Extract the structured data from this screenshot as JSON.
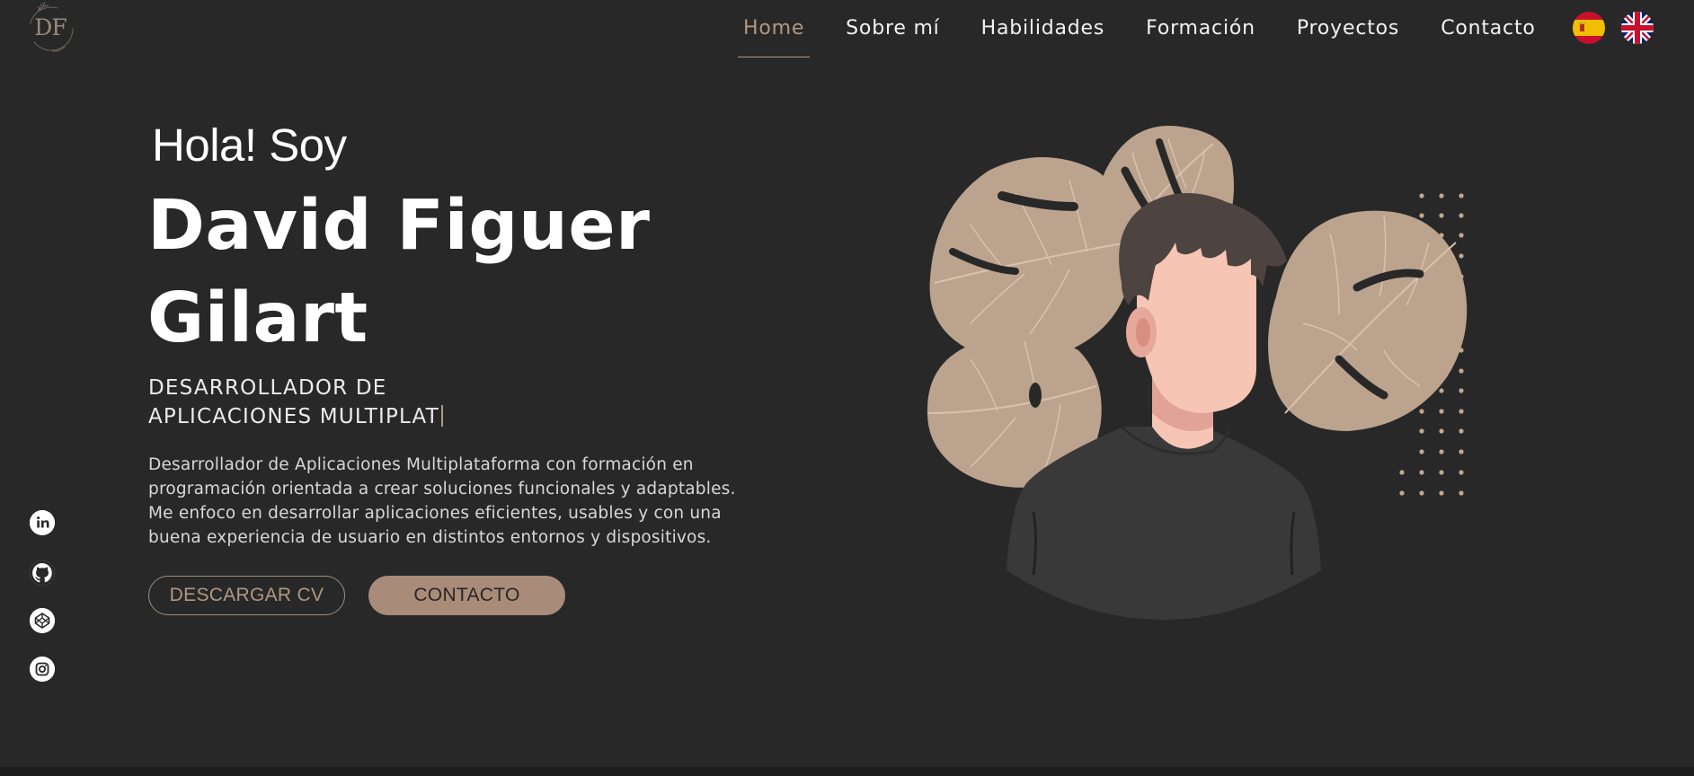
{
  "header": {
    "logo_text": "DF",
    "nav": [
      {
        "label": "Home",
        "active": true
      },
      {
        "label": "Sobre mí",
        "active": false
      },
      {
        "label": "Habilidades",
        "active": false
      },
      {
        "label": "Formación",
        "active": false
      },
      {
        "label": "Proyectos",
        "active": false
      },
      {
        "label": "Contacto",
        "active": false
      }
    ],
    "languages": [
      {
        "code": "es",
        "icon": "spain-flag-icon"
      },
      {
        "code": "en",
        "icon": "uk-flag-icon"
      }
    ]
  },
  "hero": {
    "greeting": "Hola! Soy",
    "name": "David Figuer Gilart",
    "role_line1": "DESARROLLADOR DE",
    "role_line2": "APLICACIONES MULTIPLAT",
    "description": "Desarrollador de Aplicaciones Multiplataforma con formación en programación orientada a crear soluciones funcionales y adaptables. Me enfoco en desarrollar aplicaciones eficientes, usables y con una buena experiencia de usuario en distintos entornos y dispositivos.",
    "buttons": {
      "download_cv": "DESCARGAR CV",
      "contact": "CONTACTO"
    }
  },
  "socials": [
    {
      "name": "linkedin",
      "icon": "linkedin-icon"
    },
    {
      "name": "github",
      "icon": "github-icon"
    },
    {
      "name": "codepen",
      "icon": "codepen-icon"
    },
    {
      "name": "instagram",
      "icon": "instagram-icon"
    }
  ],
  "colors": {
    "background": "#282828",
    "accent": "#b29882",
    "button_fill": "#a88c79",
    "text": "#ffffff"
  }
}
